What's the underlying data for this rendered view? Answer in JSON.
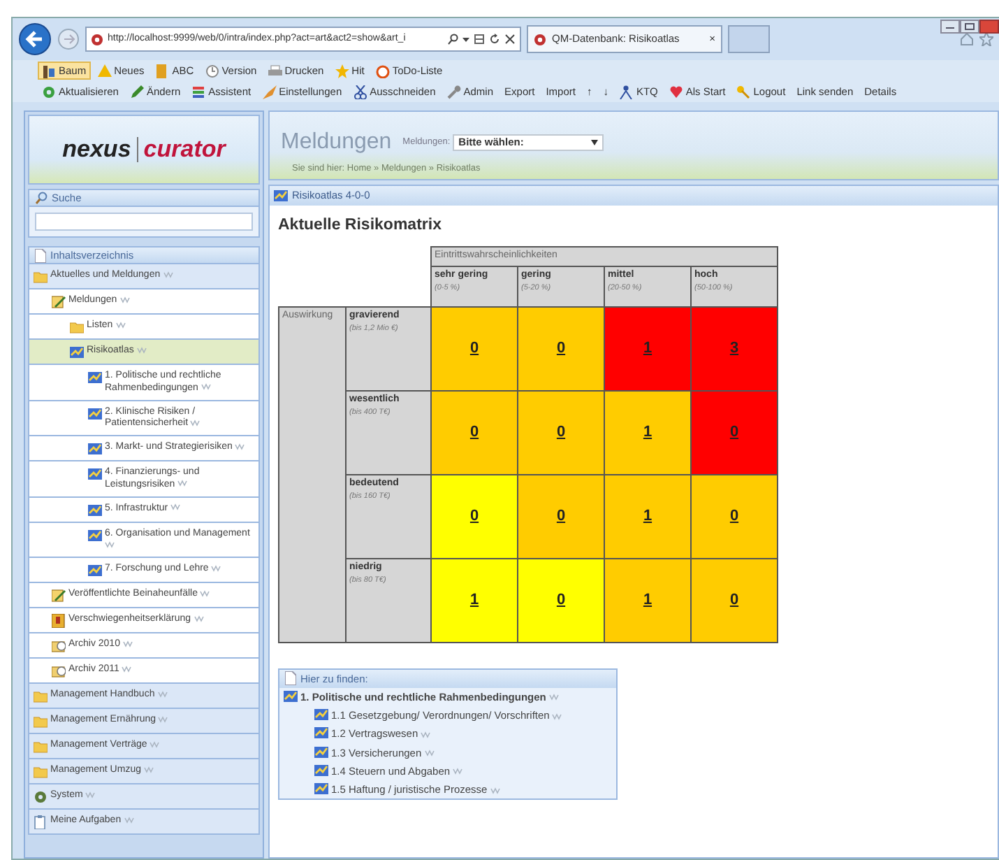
{
  "browser": {
    "url": "http://localhost:9999/web/0/intra/index.php?act=art&act2=show&art_i",
    "tab_title": "QM-Datenbank: Risikoatlas",
    "tab_close": "×"
  },
  "toolbar_rows": [
    [
      {
        "label": "Baum",
        "selected": true
      },
      {
        "label": "Neues",
        "selected": false
      },
      {
        "label": "ABC",
        "selected": false
      },
      {
        "label": "Version",
        "selected": false
      },
      {
        "label": "Drucken",
        "selected": false
      },
      {
        "label": "Hit",
        "selected": false
      },
      {
        "label": "ToDo-Liste",
        "selected": false
      }
    ],
    [
      {
        "label": "Aktualisieren",
        "selected": false
      },
      {
        "label": "Ändern",
        "selected": false
      },
      {
        "label": "Assistent",
        "selected": false
      },
      {
        "label": "Einstellungen",
        "selected": false
      },
      {
        "label": "Ausschneiden",
        "selected": false
      },
      {
        "label": "Admin",
        "selected": false
      },
      {
        "label": "Export",
        "selected": false
      },
      {
        "label": "Import",
        "selected": false
      },
      {
        "label": "↑",
        "selected": false
      },
      {
        "label": "↓",
        "selected": false
      },
      {
        "label": "KTQ",
        "selected": false
      },
      {
        "label": "Als Start",
        "selected": false
      },
      {
        "label": "Logout",
        "selected": false
      },
      {
        "label": "Link senden",
        "selected": false
      },
      {
        "label": "Details",
        "selected": false
      }
    ]
  ],
  "logo": {
    "left": "nexus",
    "right": "curator"
  },
  "header": {
    "title": "Meldungen",
    "select_label": "Meldungen:",
    "select_value": "Bitte wählen:",
    "breadcrumb": "Sie sind hier: Home » Meldungen » Risikoatlas"
  },
  "sidebar": {
    "search_title": "Suche",
    "toc_title": "Inhaltsverzeichnis",
    "items": [
      {
        "label": "Aktuelles und Meldungen",
        "kind": "folder",
        "selected": false,
        "children": [
          {
            "label": "Meldungen",
            "kind": "note",
            "selected": false,
            "children": [
              {
                "label": "Listen",
                "kind": "folder",
                "selected": false
              },
              {
                "label": "Risikoatlas",
                "kind": "chart",
                "selected": true,
                "children": [
                  {
                    "label": "1. Politische und rechtliche Rahmenbedingungen",
                    "kind": "chart",
                    "selected": false
                  },
                  {
                    "label": "2. Klinische Risiken / Patientensicherheit",
                    "kind": "chart",
                    "selected": false
                  },
                  {
                    "label": "3. Markt- und Strategierisiken",
                    "kind": "chart",
                    "selected": false
                  },
                  {
                    "label": "4. Finanzierungs- und Leistungsrisiken",
                    "kind": "chart",
                    "selected": false
                  },
                  {
                    "label": "5. Infrastruktur",
                    "kind": "chart",
                    "selected": false
                  },
                  {
                    "label": "6. Organisation und Management",
                    "kind": "chart",
                    "selected": false
                  },
                  {
                    "label": "7. Forschung und Lehre",
                    "kind": "chart",
                    "selected": false
                  }
                ]
              }
            ]
          },
          {
            "label": "Veröffentlichte Beinaheunfälle",
            "kind": "note",
            "selected": false
          },
          {
            "label": "Verschwiegenheitserklärung",
            "kind": "book",
            "selected": false
          },
          {
            "label": "Archiv 2010",
            "kind": "archive",
            "selected": false
          },
          {
            "label": "Archiv 2011",
            "kind": "archive",
            "selected": false
          }
        ]
      },
      {
        "label": "Management Handbuch",
        "kind": "folder",
        "selected": false
      },
      {
        "label": "Management Ernährung",
        "kind": "folder",
        "selected": false
      },
      {
        "label": "Management Verträge",
        "kind": "folder",
        "selected": false
      },
      {
        "label": "Management Umzug",
        "kind": "folder",
        "selected": false
      },
      {
        "label": "System",
        "kind": "gear",
        "selected": false
      },
      {
        "label": "Meine Aufgaben",
        "kind": "task",
        "selected": false
      }
    ]
  },
  "panel_title": "Risikoatlas 4-0-0",
  "matrix": {
    "title": "Aktuelle Risikomatrix",
    "x_title": "Eintrittswahrscheinlichkeiten",
    "y_title": "Auswirkung",
    "columns": [
      {
        "label": "sehr gering",
        "range": "(0-5 %)"
      },
      {
        "label": "gering",
        "range": "(5-20 %)"
      },
      {
        "label": "mittel",
        "range": "(20-50 %)"
      },
      {
        "label": "hoch",
        "range": "(50-100 %)"
      }
    ],
    "rows": [
      {
        "label": "gravierend",
        "range": "(bis 1,2 Mio €)",
        "cells": [
          {
            "value": "0",
            "color": "#ffcc00"
          },
          {
            "value": "0",
            "color": "#ffcc00"
          },
          {
            "value": "1",
            "color": "#ff0000"
          },
          {
            "value": "3",
            "color": "#ff0000"
          }
        ]
      },
      {
        "label": "wesentlich",
        "range": "(bis 400 T€)",
        "cells": [
          {
            "value": "0",
            "color": "#ffcc00"
          },
          {
            "value": "0",
            "color": "#ffcc00"
          },
          {
            "value": "1",
            "color": "#ffcc00"
          },
          {
            "value": "0",
            "color": "#ff0000"
          }
        ]
      },
      {
        "label": "bedeutend",
        "range": "(bis 160 T€)",
        "cells": [
          {
            "value": "0",
            "color": "#ffff00"
          },
          {
            "value": "0",
            "color": "#ffcc00"
          },
          {
            "value": "1",
            "color": "#ffcc00"
          },
          {
            "value": "0",
            "color": "#ffcc00"
          }
        ]
      },
      {
        "label": "niedrig",
        "range": "(bis 80 T€)",
        "cells": [
          {
            "value": "1",
            "color": "#ffff00"
          },
          {
            "value": "0",
            "color": "#ffff00"
          },
          {
            "value": "1",
            "color": "#ffcc00"
          },
          {
            "value": "0",
            "color": "#ffcc00"
          }
        ]
      }
    ]
  },
  "found": {
    "title": "Hier zu finden:",
    "items": [
      {
        "label": "1. Politische und rechtliche Rahmenbedingungen",
        "children": [
          {
            "label": "1.1 Gesetzgebung/ Verordnungen/ Vorschriften"
          },
          {
            "label": "1.2 Vertragswesen"
          },
          {
            "label": "1.3 Versicherungen"
          },
          {
            "label": "1.4 Steuern und Abgaben"
          },
          {
            "label": "1.5 Haftung / juristische Prozesse"
          }
        ]
      }
    ]
  }
}
